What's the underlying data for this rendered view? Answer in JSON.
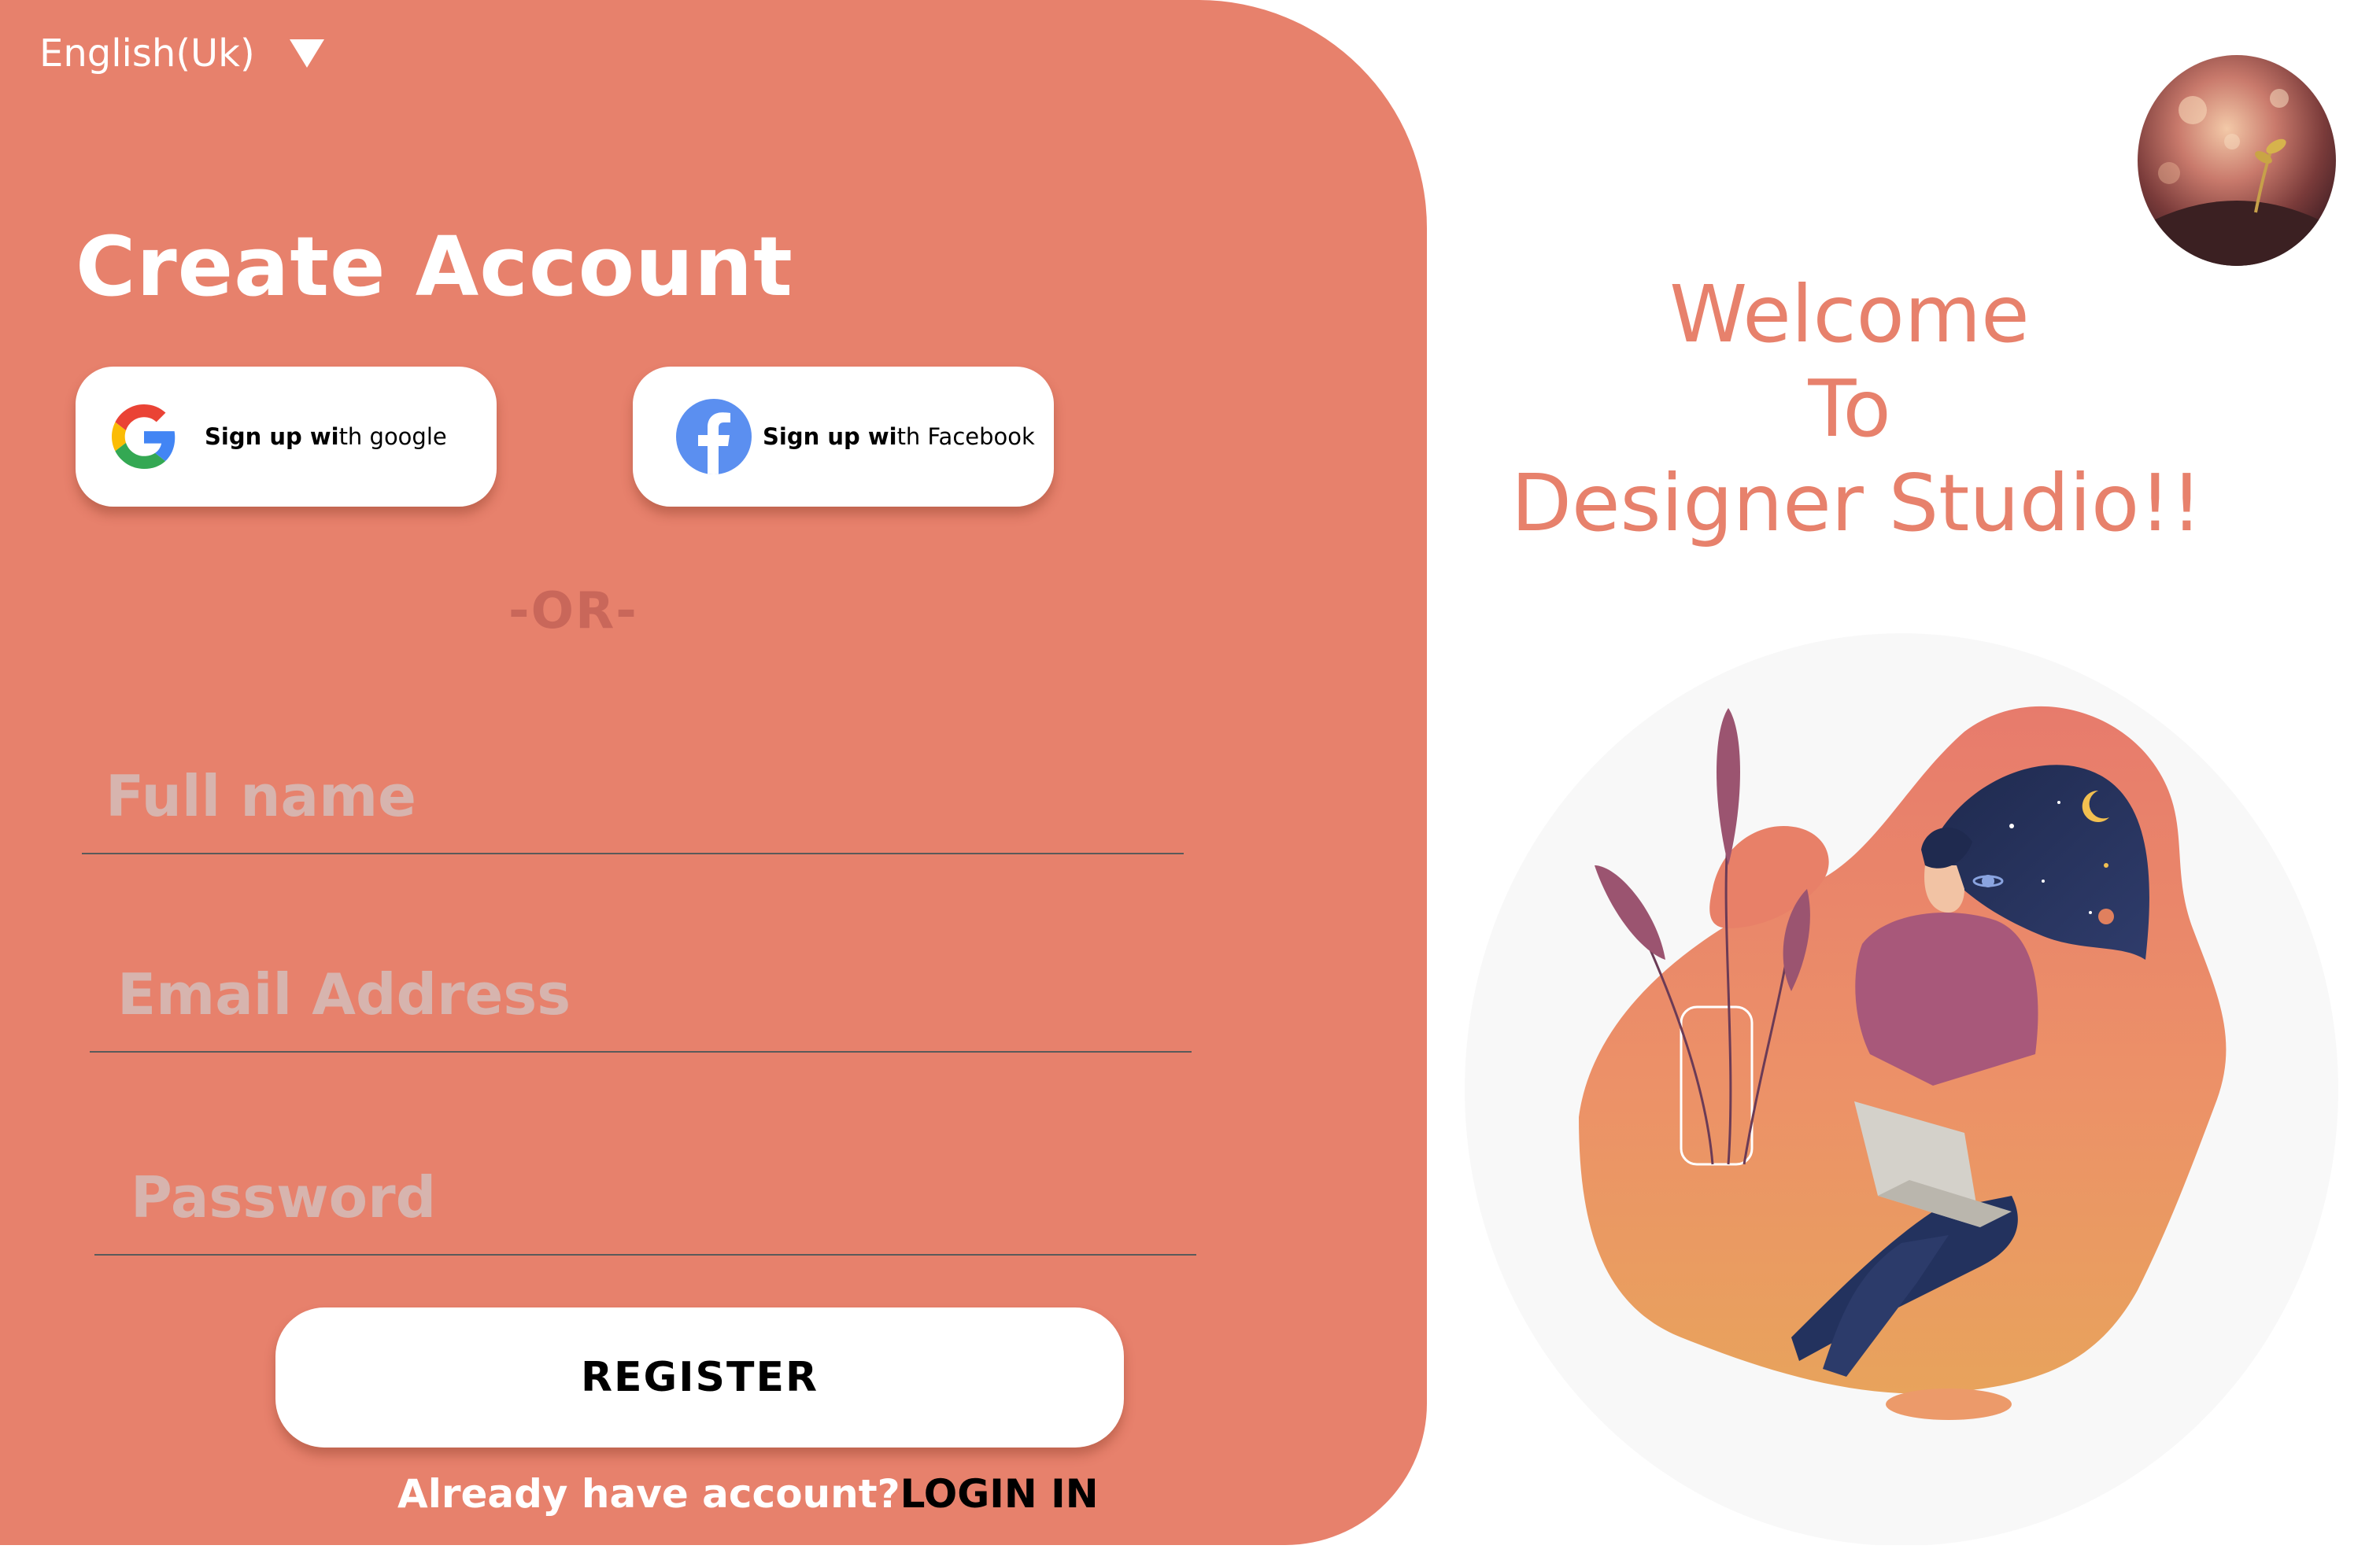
{
  "language": {
    "label": "English(Uk)"
  },
  "form": {
    "title": "Create Account",
    "google_label_bold": "Sign up wi",
    "google_label_rest": "th google",
    "facebook_label_bold": "Sign up wi",
    "facebook_label_rest": "th Facebook",
    "divider": "-OR-",
    "fullname_placeholder": "Full name",
    "email_placeholder": "Email Address",
    "password_placeholder": "Password",
    "register_label": "REGISTER",
    "login_question": "Already have account?",
    "login_link": "LOGIN IN"
  },
  "welcome": {
    "line1": "Welcome",
    "line2": "To",
    "line3": "Designer Studio!!"
  },
  "colors": {
    "accent": "#e7816c",
    "white": "#ffffff",
    "placeholder": "#d7b4ae",
    "divider_text": "#c9675a"
  },
  "icons": {
    "language": "chevron-down-icon",
    "google": "google-icon",
    "facebook": "facebook-icon"
  }
}
